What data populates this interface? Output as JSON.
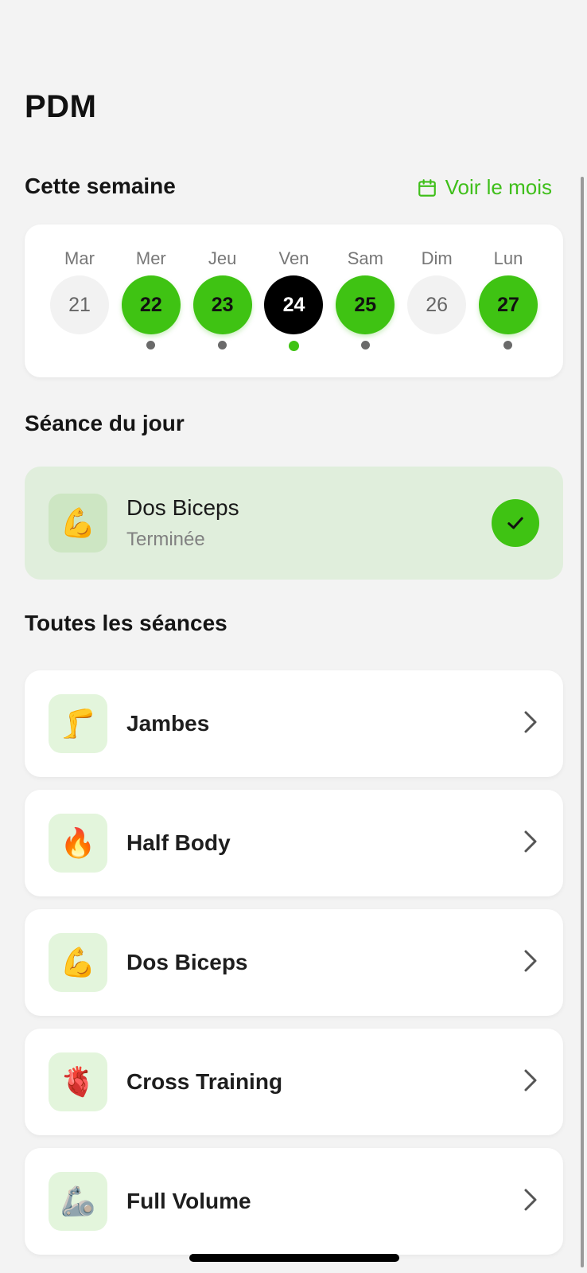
{
  "app": {
    "title": "PDM"
  },
  "week": {
    "title": "Cette semaine",
    "month_link": "Voir le mois",
    "days": [
      {
        "name": "Mar",
        "number": "21",
        "state": "inactive",
        "dot": "none"
      },
      {
        "name": "Mer",
        "number": "22",
        "state": "done",
        "dot": "gray"
      },
      {
        "name": "Jeu",
        "number": "23",
        "state": "done",
        "dot": "gray"
      },
      {
        "name": "Ven",
        "number": "24",
        "state": "today",
        "dot": "green"
      },
      {
        "name": "Sam",
        "number": "25",
        "state": "done",
        "dot": "gray"
      },
      {
        "name": "Dim",
        "number": "26",
        "state": "inactive",
        "dot": "none"
      },
      {
        "name": "Lun",
        "number": "27",
        "state": "done",
        "dot": "gray"
      }
    ]
  },
  "today": {
    "title": "Séance du jour",
    "session": {
      "name": "Dos Biceps",
      "status": "Terminée",
      "icon": "💪",
      "icon_name": "flexed-biceps-icon"
    }
  },
  "all_sessions": {
    "title": "Toutes les séances",
    "items": [
      {
        "name": "Jambes",
        "icon": "🦵",
        "icon_name": "leg-icon"
      },
      {
        "name": "Half Body",
        "icon": "🔥",
        "icon_name": "fire-icon"
      },
      {
        "name": "Dos Biceps",
        "icon": "💪",
        "icon_name": "flexed-biceps-icon"
      },
      {
        "name": "Cross Training",
        "icon": "🫀",
        "icon_name": "heart-icon"
      },
      {
        "name": "Full Volume",
        "icon": "🦾",
        "icon_name": "mechanical-arm-icon"
      }
    ]
  },
  "colors": {
    "accent": "#3fc313",
    "link": "#3fbf1a",
    "today_card": "#e0eedc"
  }
}
